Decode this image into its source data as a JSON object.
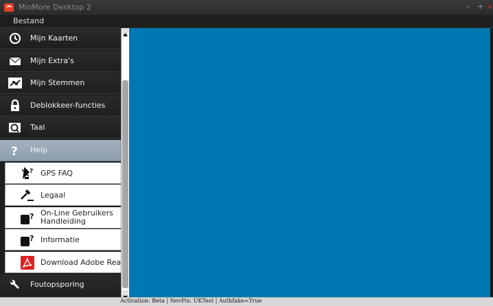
{
  "window": {
    "title": "MioMore Desktop 2",
    "controls": [
      "–",
      "+",
      "×"
    ]
  },
  "menu": {
    "file": "Bestand"
  },
  "sidebar": {
    "items": [
      {
        "label": "Mijn Kaarten",
        "icon": "clock-icon"
      },
      {
        "label": "Mijn Extra's",
        "icon": "envelope-icon"
      },
      {
        "label": "Mijn Stemmen",
        "icon": "speaker-arrows-icon"
      },
      {
        "label": "Deblokkeer-functies",
        "icon": "padlock-icon"
      },
      {
        "label": "Taal",
        "icon": "language-icon"
      },
      {
        "label": "Help",
        "icon": "question-icon",
        "active": true
      }
    ],
    "help_items": [
      {
        "label": "GPS FAQ",
        "icon": "satellite-question-icon"
      },
      {
        "label": "Legaal",
        "icon": "gavel-icon"
      },
      {
        "line1": "On-Line Gebruikers",
        "line2": "Handleiding",
        "icon": "manual-question-icon"
      },
      {
        "label": "Informatie",
        "icon": "info-question-icon"
      },
      {
        "label": "Download Adobe Reader",
        "icon": "adobe-reader-icon"
      }
    ],
    "bottom_item": {
      "label": "Foutopsporing",
      "icon": "wrench-icon"
    }
  },
  "status": {
    "text": "Activation: Beta  |  NevPix: UKTest  |  Authfake=True"
  },
  "colors": {
    "content": "#0078b4",
    "active": "#97a6b5",
    "accent": "#e8412a"
  }
}
